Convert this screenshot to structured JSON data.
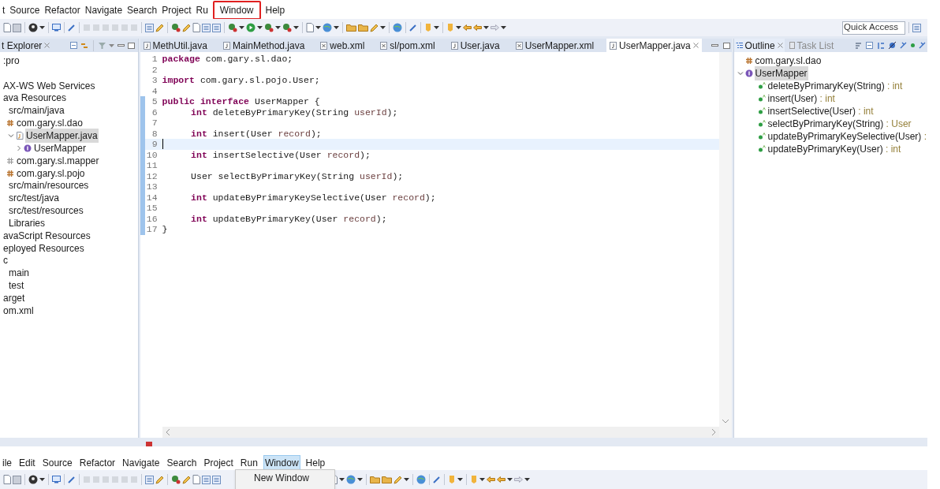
{
  "menu_bar": [
    {
      "label": "t",
      "annotated": false
    },
    {
      "label": "Source",
      "annotated": false
    },
    {
      "label": "Refactor",
      "annotated": false
    },
    {
      "label": "Navigate",
      "annotated": false
    },
    {
      "label": "Search",
      "annotated": false
    },
    {
      "label": "Project",
      "annotated": false
    },
    {
      "label": "Ru",
      "annotated": false
    },
    {
      "label": "Window",
      "annotated": true
    },
    {
      "label": "Help",
      "annotated": false
    }
  ],
  "quick_access": {
    "placeholder": "Quick Access"
  },
  "explorer": {
    "title": "t Explorer",
    "tree": [
      {
        "label": ":pro",
        "selected": false
      },
      {
        "label": "AX-WS Web Services",
        "selected": false
      },
      {
        "label": "ava Resources",
        "selected": false,
        "children": [
          {
            "label": "src/main/java",
            "selected": false,
            "children": [
              {
                "label": "com.gary.sl.dao",
                "kind": "package",
                "selected": false,
                "children": [
                  {
                    "label": "UserMapper.java",
                    "kind": "java-file",
                    "selected": true,
                    "expanded": true,
                    "children": [
                      {
                        "label": "UserMapper",
                        "kind": "interface",
                        "selected": false,
                        "expanded": false
                      }
                    ]
                  }
                ]
              },
              {
                "label": "com.gary.sl.mapper",
                "kind": "empty-package",
                "selected": false
              },
              {
                "label": "com.gary.sl.pojo",
                "kind": "package",
                "selected": false
              }
            ]
          },
          {
            "label": "src/main/resources",
            "selected": false
          },
          {
            "label": "src/test/java",
            "selected": false
          },
          {
            "label": "src/test/resources",
            "selected": false
          },
          {
            "label": "Libraries",
            "selected": false
          }
        ]
      },
      {
        "label": "avaScript Resources",
        "selected": false
      },
      {
        "label": "eployed Resources",
        "selected": false
      },
      {
        "label": "c",
        "selected": false,
        "children": [
          {
            "label": "main",
            "selected": false
          },
          {
            "label": "test",
            "selected": false
          }
        ]
      },
      {
        "label": "arget",
        "selected": false
      },
      {
        "label": "om.xml",
        "selected": false
      }
    ]
  },
  "editor": {
    "tabs": [
      {
        "label": "MethUtil.java",
        "kind": "java",
        "selected": false
      },
      {
        "label": "MainMethod.java",
        "kind": "java",
        "selected": false
      },
      {
        "label": "web.xml",
        "kind": "xml",
        "selected": false
      },
      {
        "label": "sl/pom.xml",
        "kind": "xml",
        "selected": false
      },
      {
        "label": "User.java",
        "kind": "java",
        "selected": false
      },
      {
        "label": "UserMapper.xml",
        "kind": "xml",
        "selected": false
      },
      {
        "label": "UserMapper.java",
        "kind": "java",
        "selected": true
      }
    ],
    "lines": [
      {
        "number": "1",
        "current": false,
        "changed": false,
        "tokens": [
          {
            "kind": "keyword",
            "text": "package"
          },
          {
            "kind": "plain",
            "text": " com.gary.sl.dao;"
          }
        ]
      },
      {
        "number": "2",
        "current": false,
        "changed": false
      },
      {
        "number": "3",
        "current": false,
        "changed": false,
        "tokens": [
          {
            "kind": "keyword",
            "text": "import"
          },
          {
            "kind": "plain",
            "text": " com.gary.sl.pojo.User;"
          }
        ]
      },
      {
        "number": "4",
        "current": false,
        "changed": false
      },
      {
        "number": "5",
        "current": false,
        "changed": true,
        "tokens": [
          {
            "kind": "keyword",
            "text": "public interface"
          },
          {
            "kind": "plain",
            "text": " UserMapper {"
          }
        ]
      },
      {
        "number": "6",
        "current": false,
        "changed": true,
        "indented": true,
        "tokens": [
          {
            "kind": "keyword",
            "text": "int"
          },
          {
            "kind": "plain",
            "text": " deleteByPrimaryKey(String "
          },
          {
            "kind": "param",
            "text": "userId"
          },
          {
            "kind": "plain",
            "text": ");"
          }
        ]
      },
      {
        "number": "7",
        "current": false,
        "changed": true
      },
      {
        "number": "8",
        "current": false,
        "changed": true,
        "indented": true,
        "tokens": [
          {
            "kind": "keyword",
            "text": "int"
          },
          {
            "kind": "plain",
            "text": " insert(User "
          },
          {
            "kind": "param",
            "text": "record"
          },
          {
            "kind": "plain",
            "text": ");"
          }
        ]
      },
      {
        "number": "9",
        "current": true,
        "changed": true
      },
      {
        "number": "10",
        "current": false,
        "changed": true,
        "indented": true,
        "tokens": [
          {
            "kind": "keyword",
            "text": "int"
          },
          {
            "kind": "plain",
            "text": " insertSelective(User "
          },
          {
            "kind": "param",
            "text": "record"
          },
          {
            "kind": "plain",
            "text": ");"
          }
        ]
      },
      {
        "number": "11",
        "current": false,
        "changed": true
      },
      {
        "number": "12",
        "current": false,
        "changed": true,
        "indented": true,
        "tokens": [
          {
            "kind": "plain",
            "text": "User selectByPrimaryKey(String "
          },
          {
            "kind": "param",
            "text": "userId"
          },
          {
            "kind": "plain",
            "text": ");"
          }
        ]
      },
      {
        "number": "13",
        "current": false,
        "changed": true
      },
      {
        "number": "14",
        "current": false,
        "changed": true,
        "indented": true,
        "tokens": [
          {
            "kind": "keyword",
            "text": "int"
          },
          {
            "kind": "plain",
            "text": " updateByPrimaryKeySelective(User "
          },
          {
            "kind": "param",
            "text": "record"
          },
          {
            "kind": "plain",
            "text": ");"
          }
        ]
      },
      {
        "number": "15",
        "current": false,
        "changed": true
      },
      {
        "number": "16",
        "current": false,
        "changed": true,
        "indented": true,
        "tokens": [
          {
            "kind": "keyword",
            "text": "int"
          },
          {
            "kind": "plain",
            "text": " updateByPrimaryKey(User "
          },
          {
            "kind": "param",
            "text": "record"
          },
          {
            "kind": "plain",
            "text": ");"
          }
        ]
      },
      {
        "number": "17",
        "current": false,
        "changed": true,
        "tokens": [
          {
            "kind": "plain",
            "text": "}"
          }
        ]
      }
    ]
  },
  "outline": {
    "tabs": [
      {
        "label": "Outline",
        "selected": true
      },
      {
        "label": "Task List",
        "selected": false
      }
    ],
    "items": [
      {
        "label": "com.gary.sl.dao",
        "kind": "package",
        "selected": false
      },
      {
        "label": "UserMapper",
        "kind": "interface",
        "selected": true,
        "expanded": true,
        "children": [
          {
            "label": "deleteByPrimaryKey(String)",
            "type": ": int",
            "kind": "method",
            "selected": false
          },
          {
            "label": "insert(User)",
            "type": ": int",
            "kind": "method",
            "selected": false
          },
          {
            "label": "insertSelective(User)",
            "type": ": int",
            "kind": "method",
            "selected": false
          },
          {
            "label": "selectByPrimaryKey(String)",
            "type": ": User",
            "kind": "method",
            "selected": false
          },
          {
            "label": "updateByPrimaryKeySelective(User)",
            "type": ":",
            "kind": "method",
            "selected": false
          },
          {
            "label": "updateByPrimaryKey(User)",
            "type": ": int",
            "kind": "method",
            "selected": false
          }
        ]
      }
    ]
  },
  "second_menu_bar": [
    {
      "label": "ile",
      "selected": false
    },
    {
      "label": "Edit",
      "selected": false
    },
    {
      "label": "Source",
      "selected": false
    },
    {
      "label": "Refactor",
      "selected": false
    },
    {
      "label": "Navigate",
      "selected": false
    },
    {
      "label": "Search",
      "selected": false
    },
    {
      "label": "Project",
      "selected": false
    },
    {
      "label": "Run",
      "selected": false
    },
    {
      "label": "Window",
      "selected": true
    },
    {
      "label": "Help",
      "selected": false
    }
  ],
  "window_menu": {
    "items": [
      {
        "label": "New Window"
      }
    ]
  }
}
